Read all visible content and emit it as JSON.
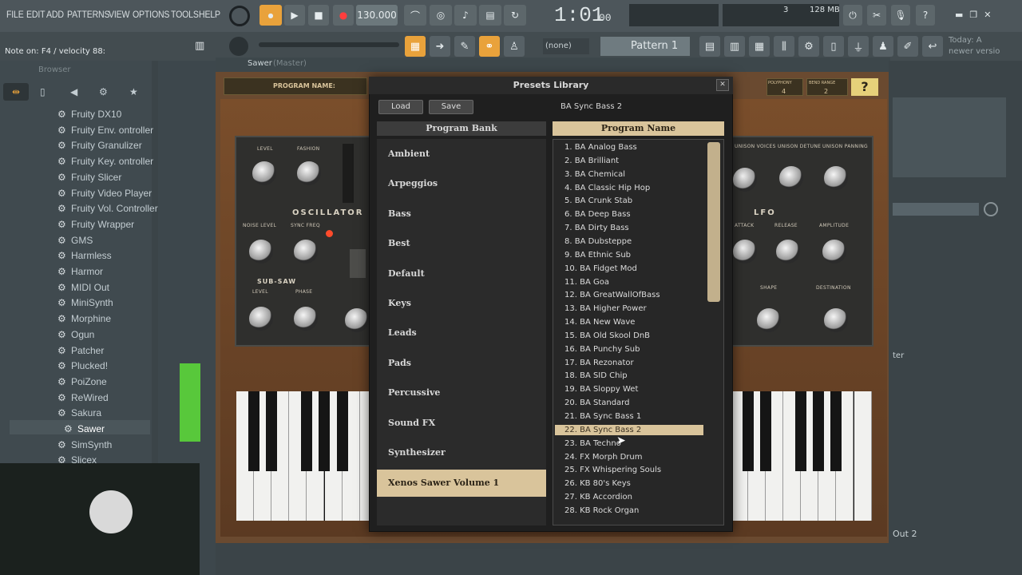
{
  "menu": [
    "FILE",
    "EDIT",
    "ADD",
    "PATTERNS",
    "VIEW",
    "OPTIONS",
    "TOOLS",
    "HELP"
  ],
  "transport": {
    "tempo": "130.000",
    "time": "1:01",
    "time_small": "00",
    "pat_label": "Pattern 1",
    "none_label": "(none)",
    "memory": "128 MB",
    "cpu": "3",
    "hint_title": "Today: A",
    "hint_sub": "newer versio"
  },
  "status_hint": "Note on: F4 / velocity 88:",
  "browser": {
    "title": "Browser",
    "items": [
      "Fruity DX10",
      "Fruity Env. ontroller",
      "Fruity Granulizer",
      "Fruity Key. ontroller",
      "Fruity Slicer",
      "Fruity Video Player",
      "Fruity Vol. Controller",
      "Fruity Wrapper",
      "GMS",
      "Harmless",
      "Harmor",
      "MIDI Out",
      "MiniSynth",
      "Morphine",
      "Ogun",
      "Patcher",
      "Plucked!",
      "PoiZone",
      "ReWired",
      "Sakura",
      "Sawer",
      "SimSynth",
      "Slicex"
    ]
  },
  "plugin": {
    "window_title": "Sawer",
    "window_sub": "(Master)",
    "program_name_label": "PROGRAM NAME:",
    "polyphony": "POLYPHONY",
    "polyphony_val": "4",
    "bend_range": "BEND RANGE",
    "bend_val": "2",
    "help": "?",
    "oscillator": "OSCILLATOR",
    "sub_saw": "SUB-SAW",
    "lfo": "LFO",
    "level": "LEVEL",
    "fashion": "FASHION",
    "noise_level": "NOISE LEVEL",
    "sync_freq": "SYNC FREQ",
    "sub_level": "LEVEL",
    "phase": "PHASE",
    "unison_voices": "UNISON VOICES",
    "unison_detune": "UNISON DETUNE",
    "unison_panning": "UNISON PANNING",
    "attack": "ATTACK",
    "release": "RELEASE",
    "amplitude": "AMPLITUDE",
    "shape": "SHAPE",
    "destination": "DESTINATION"
  },
  "dialog": {
    "title": "Presets Library",
    "load": "Load",
    "save": "Save",
    "current": "BA Sync Bass 2",
    "bank_header": "Program Bank",
    "name_header": "Program Name",
    "banks": [
      "Ambient",
      "Arpeggios",
      "Bass",
      "Best",
      "Default",
      "Keys",
      "Leads",
      "Pads",
      "Percussive",
      "Sound FX",
      "Synthesizer",
      "Xenos Sawer Volume 1"
    ],
    "selected_bank": "Xenos Sawer Volume 1",
    "programs": [
      "1. BA Analog Bass",
      "2. BA Brilliant",
      "3. BA Chemical",
      "4. BA Classic Hip Hop",
      "5. BA Crunk Stab",
      "6. BA Deep Bass",
      "7. BA Dirty Bass",
      "8. BA Dubsteppe",
      "9. BA Ethnic Sub",
      "10. BA Fidget Mod",
      "11. BA Goa",
      "12. BA GreatWallOfBass",
      "13. BA Higher Power",
      "14. BA New Wave",
      "15. BA Old Skool DnB",
      "16. BA Punchy Sub",
      "17. BA Rezonator",
      "18. BA SID Chip",
      "19. BA Sloppy Wet",
      "20. BA Standard",
      "21. BA Sync Bass 1",
      "22. BA Sync Bass 2",
      "23. BA Techno",
      "24. FX Morph Drum",
      "25. FX Whispering Souls",
      "26. KB 80's Keys",
      "27. KB Accordion",
      "28. KB Rock Organ"
    ],
    "selected_program": "22. BA Sync Bass 2"
  },
  "mixer": {
    "track": "Out 2",
    "label_ter": "ter"
  },
  "colors": {
    "accent": "#e9a23b",
    "selection": "#d9c49b",
    "wood": "#6a4a30"
  }
}
